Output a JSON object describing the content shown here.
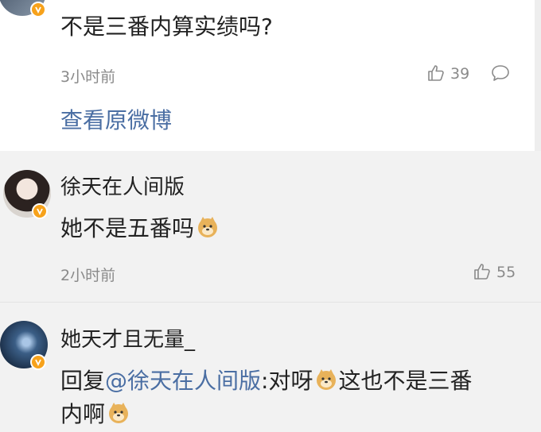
{
  "post_top": {
    "comment_text": "不是三番内算实绩吗?",
    "time": "3小时前",
    "likes": "39",
    "view_original_label": "查看原微博"
  },
  "reply_1": {
    "username": "徐天在人间版",
    "text": "她不是五番吗",
    "time": "2小时前",
    "likes": "55"
  },
  "reply_2": {
    "username": "她天才且无量_",
    "reply_prefix": "回复",
    "mention": "@徐天在人间版",
    "text_part1": ":对呀",
    "text_part2": "这也不是三番",
    "text_line2": "内啊"
  },
  "icons": [
    "verified-badge-icon",
    "thumbs-up-icon",
    "comment-bubble-icon",
    "doge-emoji-icon"
  ],
  "colors": {
    "link": "#4a6ea3",
    "meta": "#8a8a8a",
    "verified_badge": "#f7a21b",
    "background": "#f2f2f2"
  }
}
